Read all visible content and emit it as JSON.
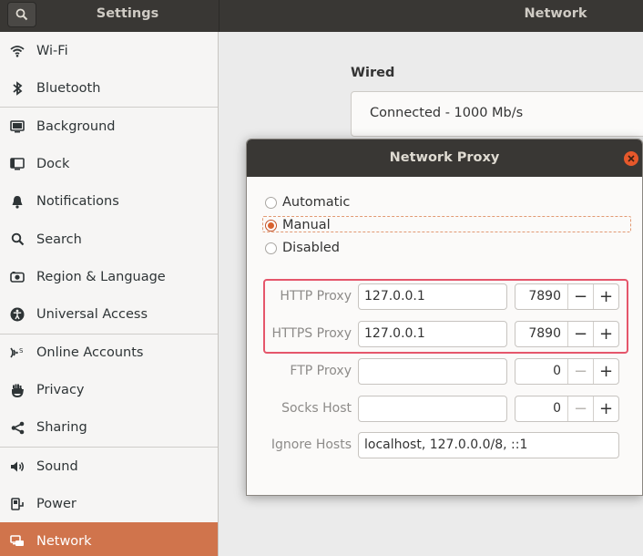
{
  "header": {
    "left_title": "Settings",
    "right_title": "Network"
  },
  "sidebar": {
    "items": [
      {
        "label": "Wi-Fi",
        "icon": "wifi-icon"
      },
      {
        "label": "Bluetooth",
        "icon": "bluetooth-icon"
      },
      {
        "label": "Background",
        "icon": "background-icon"
      },
      {
        "label": "Dock",
        "icon": "dock-icon"
      },
      {
        "label": "Notifications",
        "icon": "bell-icon"
      },
      {
        "label": "Search",
        "icon": "search-icon"
      },
      {
        "label": "Region & Language",
        "icon": "camera-icon"
      },
      {
        "label": "Universal Access",
        "icon": "accessibility-icon"
      },
      {
        "label": "Online Accounts",
        "icon": "online-accounts-icon"
      },
      {
        "label": "Privacy",
        "icon": "hand-icon"
      },
      {
        "label": "Sharing",
        "icon": "share-icon"
      },
      {
        "label": "Sound",
        "icon": "speaker-icon"
      },
      {
        "label": "Power",
        "icon": "power-icon"
      },
      {
        "label": "Network",
        "icon": "network-icon"
      }
    ],
    "active": "Network"
  },
  "main": {
    "wired_label": "Wired",
    "wired_status": "Connected - 1000 Mb/s"
  },
  "dialog": {
    "title": "Network Proxy",
    "modes": [
      {
        "label": "Automatic",
        "selected": false
      },
      {
        "label": "Manual",
        "selected": true
      },
      {
        "label": "Disabled",
        "selected": false
      }
    ],
    "fields": {
      "http": {
        "label": "HTTP Proxy",
        "host": "127.0.0.1",
        "port": "7890"
      },
      "https": {
        "label": "HTTPS Proxy",
        "host": "127.0.0.1",
        "port": "7890"
      },
      "ftp": {
        "label": "FTP Proxy",
        "host": "",
        "port": "0"
      },
      "socks": {
        "label": "Socks Host",
        "host": "",
        "port": "0"
      },
      "ignore": {
        "label": "Ignore Hosts",
        "value": "localhost, 127.0.0.0/8, ::1"
      }
    },
    "stepper": {
      "minus": "−",
      "plus": "+"
    }
  },
  "colors": {
    "accent": "#d0744c",
    "highlight": "#e5566b",
    "headerbar": "#393734"
  }
}
